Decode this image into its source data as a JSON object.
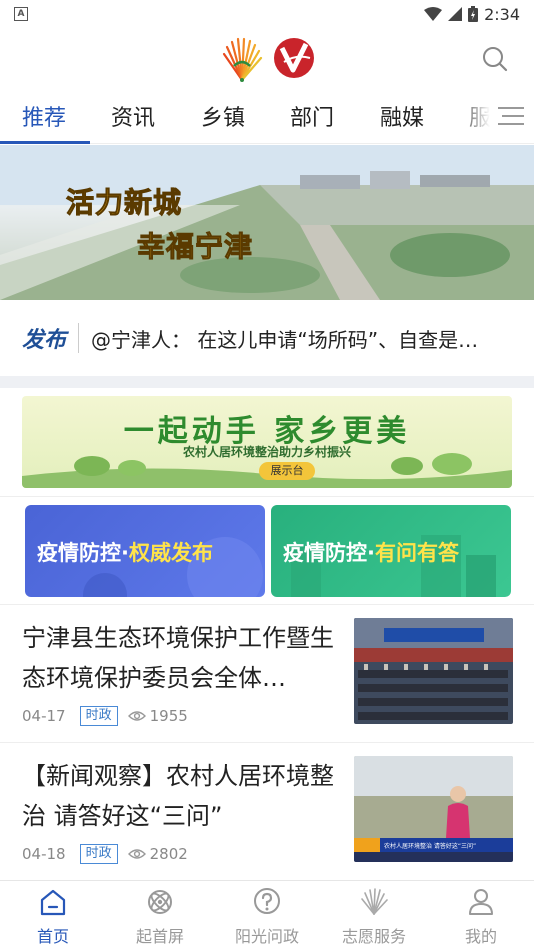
{
  "status_bar": {
    "time": "2:34",
    "app_badge": "A"
  },
  "tabs": [
    {
      "label": "推荐",
      "active": true
    },
    {
      "label": "资讯"
    },
    {
      "label": "乡镇"
    },
    {
      "label": "部门"
    },
    {
      "label": "融媒"
    },
    {
      "label": "服"
    }
  ],
  "hero_banner": {
    "line1": "活力新城",
    "line2": "幸福宁津"
  },
  "publish": {
    "brand": "发布",
    "text": "@宁津人： 在这儿申请“场所码”、自查是…"
  },
  "promo_banner": {
    "headline": "一起动手   家乡更美",
    "subtitle": "农村人居环境整治助力乡村振兴",
    "badge": "展示台"
  },
  "cards": [
    {
      "prefix": "疫情防控·",
      "highlight": "权威发布",
      "color": "#4a64d6"
    },
    {
      "prefix": "疫情防控·",
      "highlight": "有问有答",
      "color": "#28b07d"
    }
  ],
  "news": [
    {
      "title": "宁津县生态环境保护工作暨生态环境保护委员会全体…",
      "date": "04-17",
      "tag": "时政",
      "views": "1955"
    },
    {
      "title": "【新闻观察】农村人居环境整治 请答好这“三问”",
      "date": "04-18",
      "tag": "时政",
      "views": "2802",
      "thumb_caption": "农村人居环境整治 请答好这“三问”"
    }
  ],
  "bottom_nav": [
    {
      "label": "首页",
      "icon": "home-icon",
      "active": true
    },
    {
      "label": "起首屏",
      "icon": "atom-icon"
    },
    {
      "label": "阳光问政",
      "icon": "question-icon"
    },
    {
      "label": "志愿服务",
      "icon": "volunteer-icon"
    },
    {
      "label": "我的",
      "icon": "user-icon"
    }
  ],
  "colors": {
    "accent": "#2757b8",
    "tag": "#3a7ac6"
  }
}
